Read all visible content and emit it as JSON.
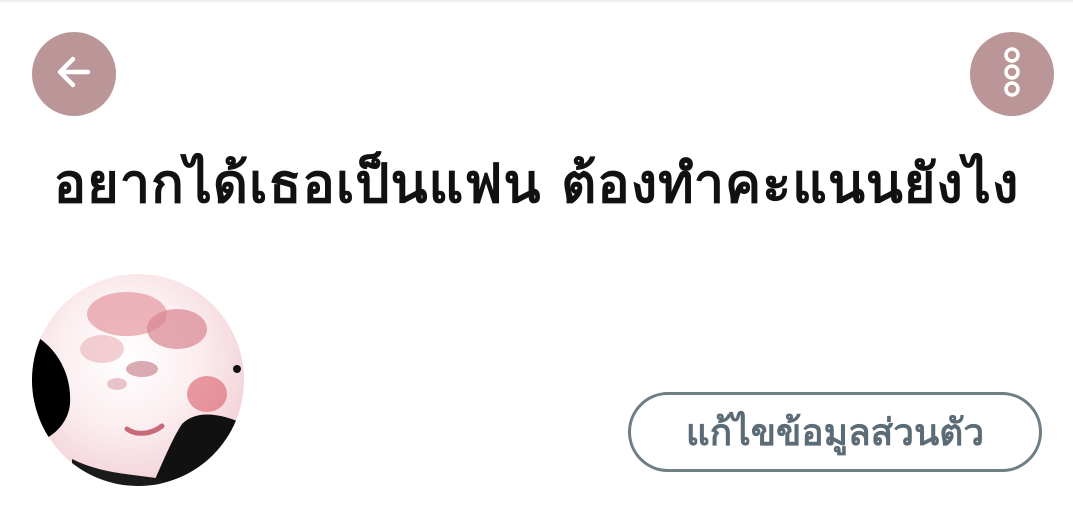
{
  "header": {
    "back_icon": "arrow-left-icon",
    "more_icon": "more-vertical-icon",
    "accent_color": "#bb9698"
  },
  "profile": {
    "title": "อยากได้เธอเป็นแฟน ต้องทำคะแนนยังไง",
    "avatar": "profile-photo",
    "edit_button_label": "แก้ไขข้อมูลส่วนตัว"
  }
}
